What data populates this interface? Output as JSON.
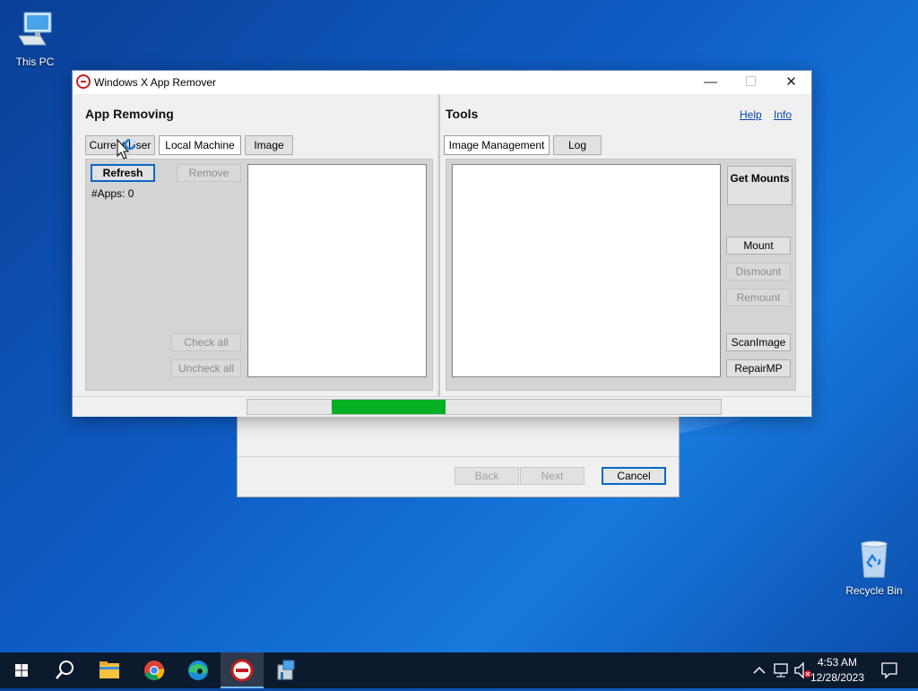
{
  "desktop": {
    "this_pc_label": "This PC",
    "recycle_bin_label": "Recycle Bin"
  },
  "background_dialog": {
    "back_label": "Back",
    "next_label": "Next",
    "cancel_label": "Cancel"
  },
  "window": {
    "title": "Windows X App Remover",
    "left_panel": {
      "title": "App Removing",
      "tabs": [
        "Current User",
        "Local Machine",
        "Image"
      ],
      "selected_tab": "Local Machine",
      "refresh_label": "Refresh",
      "remove_label": "Remove",
      "apps_count_text": "#Apps: 0",
      "check_all_label": "Check all",
      "uncheck_all_label": "Uncheck all"
    },
    "right_panel": {
      "title": "Tools",
      "help_label": "Help",
      "info_label": "Info",
      "tabs": [
        "Image Management",
        "Log"
      ],
      "selected_tab": "Image Management",
      "get_mounts_label": "Get Mounts",
      "mount_label": "Mount",
      "dismount_label": "Dismount",
      "remount_label": "Remount",
      "scanimage_label": "ScanImage",
      "repairmp_label": "RepairMP"
    },
    "progress": {
      "fill_start_fraction": 0.178,
      "fill_fraction": 0.24,
      "color": "#06b025"
    }
  },
  "taskbar": {
    "apps": [
      "start-icon",
      "search-icon",
      "file-explorer-icon",
      "chrome-icon",
      "edge-icon",
      "app-remover-icon",
      "installer-icon"
    ],
    "time": "4:53 AM",
    "date": "12/28/2023"
  },
  "colors": {
    "accent": "#0a67c5",
    "desktop": "#0f5fc7",
    "taskbar": "#0c1a2e"
  }
}
